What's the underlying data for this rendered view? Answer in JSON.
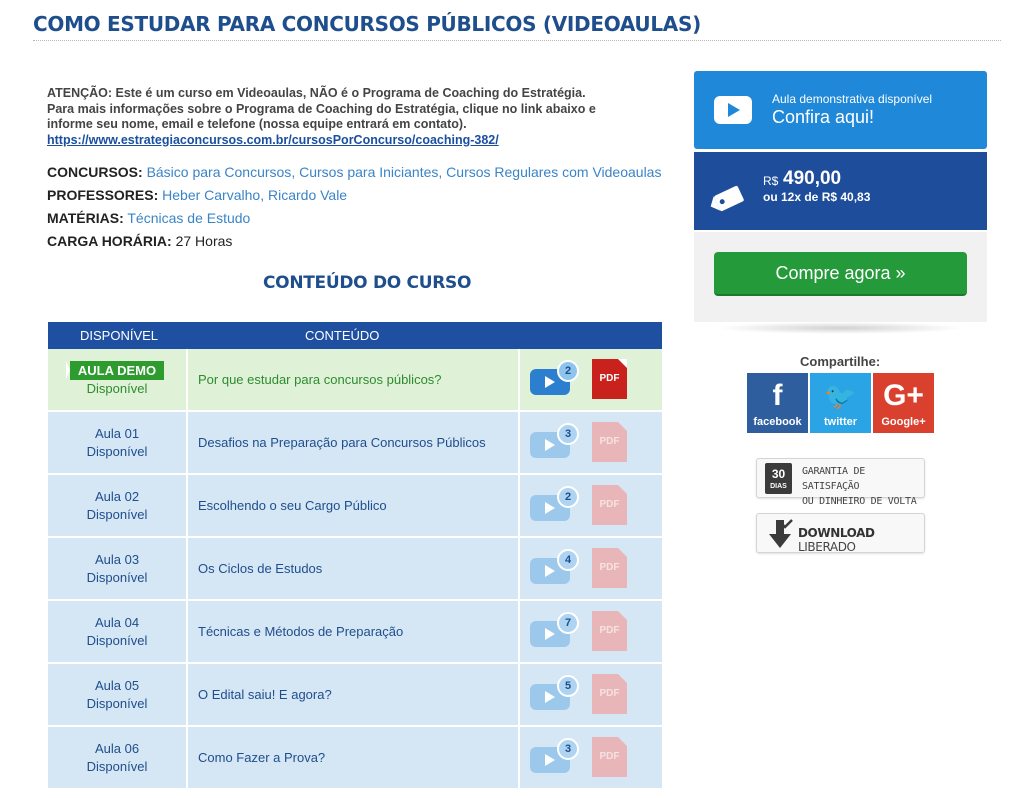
{
  "page": {
    "title": "COMO ESTUDAR PARA CONCURSOS PÚBLICOS (VIDEOAULAS)"
  },
  "notice": {
    "line1": "ATENÇÃO: Este é um curso em Videoaulas, NÃO é o Programa de Coaching do Estratégia.",
    "line2": "Para mais informações sobre o Programa de Coaching do Estratégia, clique no link abaixo e",
    "line3": "informe seu nome, email e telefone (nossa equipe entrará em contato).",
    "link": "https://www.estrategiaconcursos.com.br/cursosPorConcurso/coaching-382/"
  },
  "meta": {
    "concursos_label": "CONCURSOS:",
    "concursos": [
      "Básico para Concursos",
      "Cursos para Iniciantes",
      "Cursos Regulares com Videoaulas"
    ],
    "professores_label": "PROFESSORES:",
    "professores": [
      "Heber Carvalho",
      "Ricardo Vale"
    ],
    "materias_label": "MATÉRIAS:",
    "materias": [
      "Técnicas de Estudo"
    ],
    "carga_label": "CARGA HORÁRIA:",
    "carga": "27 Horas",
    "separator": ","
  },
  "content": {
    "section_title": "CONTEÚDO DO CURSO",
    "col_status": "DISPONÍVEL",
    "col_content": "CONTEÚDO",
    "pdf_label": "PDF",
    "rows": [
      {
        "badge": "AULA DEMO",
        "status": "Disponível",
        "title": "Por que estudar para concursos públicos?",
        "videos": "2"
      },
      {
        "lesson": "Aula 01",
        "status": "Disponível",
        "title": "Desafios na Preparação para Concursos Públicos",
        "videos": "3"
      },
      {
        "lesson": "Aula 02",
        "status": "Disponível",
        "title": "Escolhendo o seu Cargo Público",
        "videos": "2"
      },
      {
        "lesson": "Aula 03",
        "status": "Disponível",
        "title": "Os Ciclos de Estudos",
        "videos": "4"
      },
      {
        "lesson": "Aula 04",
        "status": "Disponível",
        "title": "Técnicas e Métodos de Preparação",
        "videos": "7"
      },
      {
        "lesson": "Aula 05",
        "status": "Disponível",
        "title": "O Edital saiu! E agora?",
        "videos": "5"
      },
      {
        "lesson": "Aula 06",
        "status": "Disponível",
        "title": "Como Fazer a Prova?",
        "videos": "3"
      }
    ]
  },
  "sidebar": {
    "demo_small": "Aula demonstrativa disponível",
    "demo_big": "Confira aqui!",
    "currency": "R$",
    "price": "490,00",
    "installments": "ou 12x de R$ 40,83",
    "buy": "Compre agora »",
    "share_label": "Compartilhe:",
    "share": {
      "facebook_glyph": "f",
      "facebook": "facebook",
      "twitter_glyph": "🐦",
      "twitter": "twitter",
      "google_glyph": "G+",
      "google": "Google+"
    },
    "guarantee_days_num": "30",
    "guarantee_days_word": "DIAS",
    "guarantee_line1": "GARANTIA DE SATISFAÇÃO",
    "guarantee_line2": "OU DINHEIRO DE VOLTA",
    "download_bold": "DOWNLOAD",
    "download_rest": "LIBERADO"
  }
}
